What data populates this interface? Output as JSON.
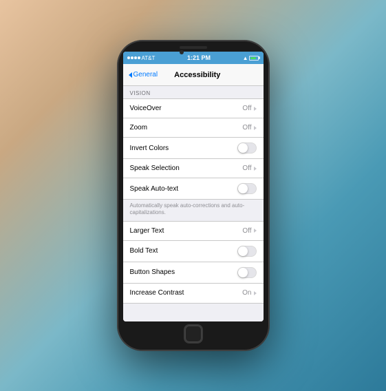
{
  "phone": {
    "status_bar": {
      "carrier": "AT&T",
      "signal_dots": 4,
      "time": "1:21 PM",
      "wifi": true,
      "battery_percent": 80
    },
    "nav": {
      "back_label": "General",
      "title": "Accessibility"
    },
    "sections": [
      {
        "header": "VISION",
        "rows": [
          {
            "label": "VoiceOver",
            "type": "disclosure",
            "value": "Off"
          },
          {
            "label": "Zoom",
            "type": "disclosure",
            "value": "Off"
          },
          {
            "label": "Invert Colors",
            "type": "toggle",
            "on": false
          },
          {
            "label": "Speak Selection",
            "type": "disclosure",
            "value": "Off"
          },
          {
            "label": "Speak Auto-text",
            "type": "toggle",
            "on": false
          },
          {
            "label": "description",
            "type": "description",
            "text": "Automatically speak auto-corrections and auto-capitalizations."
          }
        ]
      },
      {
        "header": "",
        "rows": [
          {
            "label": "Larger Text",
            "type": "disclosure",
            "value": "Off"
          },
          {
            "label": "Bold Text",
            "type": "toggle",
            "on": false
          },
          {
            "label": "Button Shapes",
            "type": "toggle",
            "on": false
          },
          {
            "label": "Increase Contrast",
            "type": "disclosure",
            "value": "On"
          }
        ]
      }
    ]
  }
}
